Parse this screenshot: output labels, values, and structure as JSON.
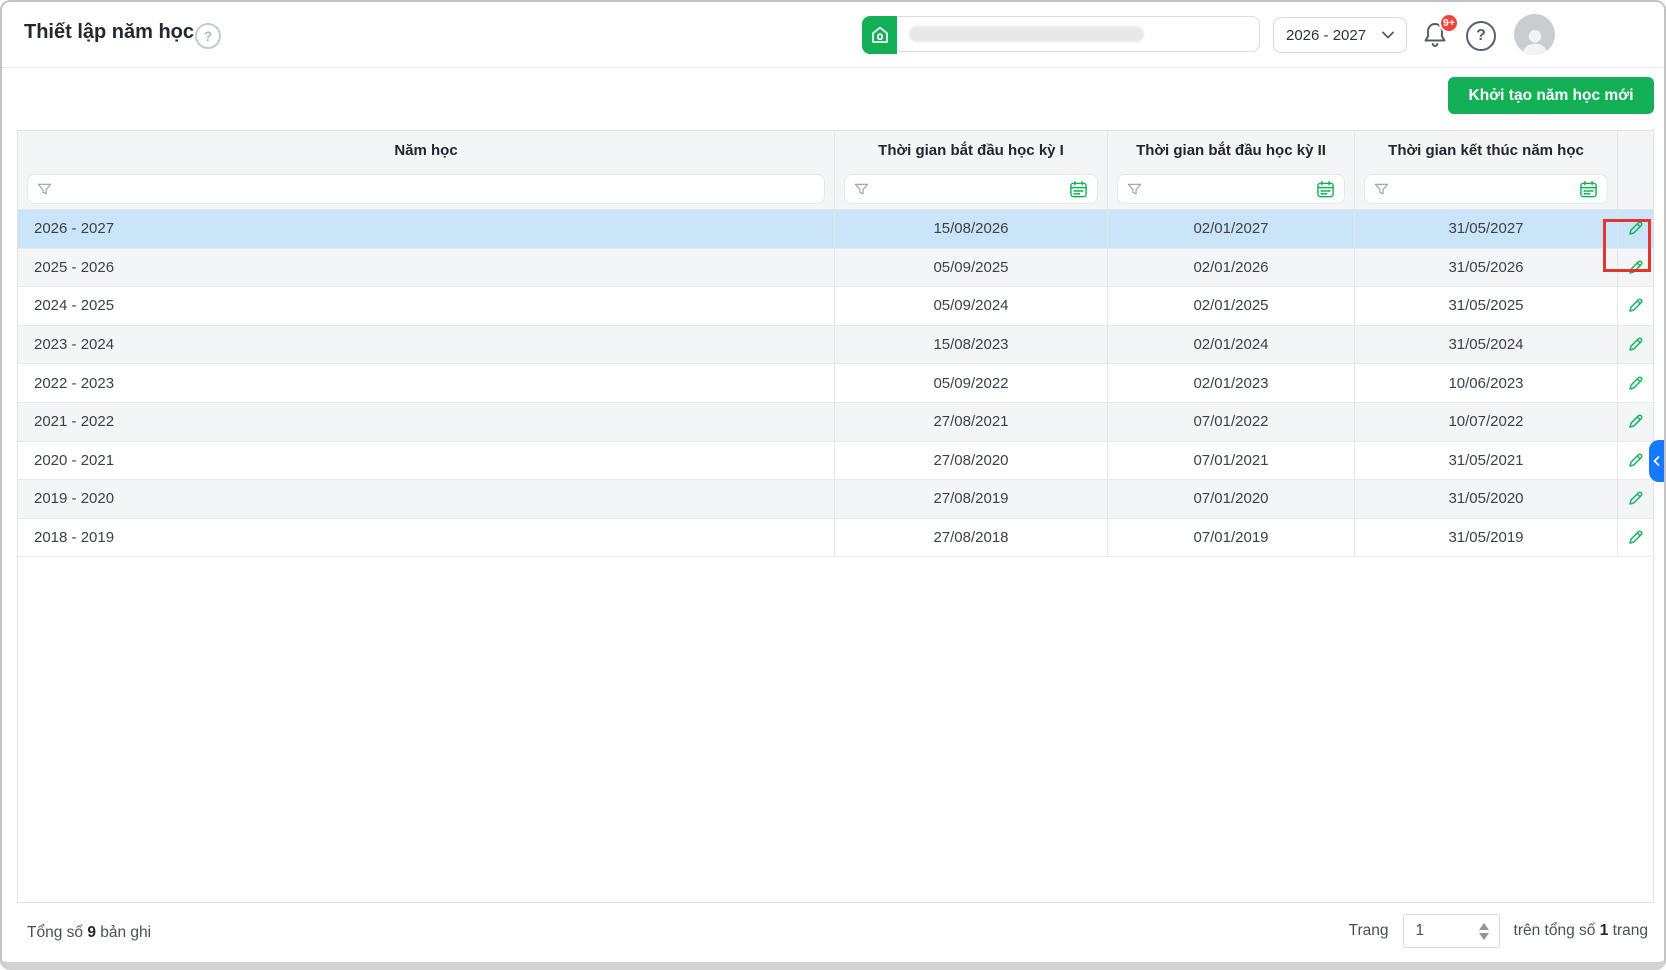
{
  "header": {
    "title": "Thiết lập năm học",
    "help_icon": "?",
    "year_selector_value": "2026 - 2027",
    "notification_badge": "9+"
  },
  "toolbar": {
    "create_button": "Khởi tạo năm học mới"
  },
  "table": {
    "columns": [
      "Năm học",
      "Thời gian bắt đầu học kỳ I",
      "Thời gian bắt đầu học kỳ II",
      "Thời gian kết thúc năm học"
    ],
    "rows": [
      {
        "year": "2026 - 2027",
        "sem1_start": "15/08/2026",
        "sem2_start": "02/01/2027",
        "year_end": "31/05/2027",
        "selected": true,
        "annotated": true
      },
      {
        "year": "2025 - 2026",
        "sem1_start": "05/09/2025",
        "sem2_start": "02/01/2026",
        "year_end": "31/05/2026",
        "selected": false,
        "annotated": false
      },
      {
        "year": "2024 - 2025",
        "sem1_start": "05/09/2024",
        "sem2_start": "02/01/2025",
        "year_end": "31/05/2025",
        "selected": false,
        "annotated": false
      },
      {
        "year": "2023 - 2024",
        "sem1_start": "15/08/2023",
        "sem2_start": "02/01/2024",
        "year_end": "31/05/2024",
        "selected": false,
        "annotated": false
      },
      {
        "year": "2022 - 2023",
        "sem1_start": "05/09/2022",
        "sem2_start": "02/01/2023",
        "year_end": "10/06/2023",
        "selected": false,
        "annotated": false
      },
      {
        "year": "2021 - 2022",
        "sem1_start": "27/08/2021",
        "sem2_start": "07/01/2022",
        "year_end": "10/07/2022",
        "selected": false,
        "annotated": false
      },
      {
        "year": "2020 - 2021",
        "sem1_start": "27/08/2020",
        "sem2_start": "07/01/2021",
        "year_end": "31/05/2021",
        "selected": false,
        "annotated": false
      },
      {
        "year": "2019 - 2020",
        "sem1_start": "27/08/2019",
        "sem2_start": "07/01/2020",
        "year_end": "31/05/2020",
        "selected": false,
        "annotated": false
      },
      {
        "year": "2018 - 2019",
        "sem1_start": "27/08/2018",
        "sem2_start": "07/01/2019",
        "year_end": "31/05/2019",
        "selected": false,
        "annotated": false
      }
    ]
  },
  "footer": {
    "total_prefix": "Tổng số",
    "total_count": "9",
    "total_suffix": "bản ghi",
    "page_label": "Trang",
    "page_value": "1",
    "of_prefix": "trên tổng số",
    "page_total": "1",
    "of_suffix": "trang"
  },
  "colors": {
    "accent_green": "#13b057",
    "selected_row": "#cbe5f8",
    "annotation_red": "#e5352f",
    "side_tab_blue": "#1677ff",
    "badge_red": "#f5413d"
  }
}
